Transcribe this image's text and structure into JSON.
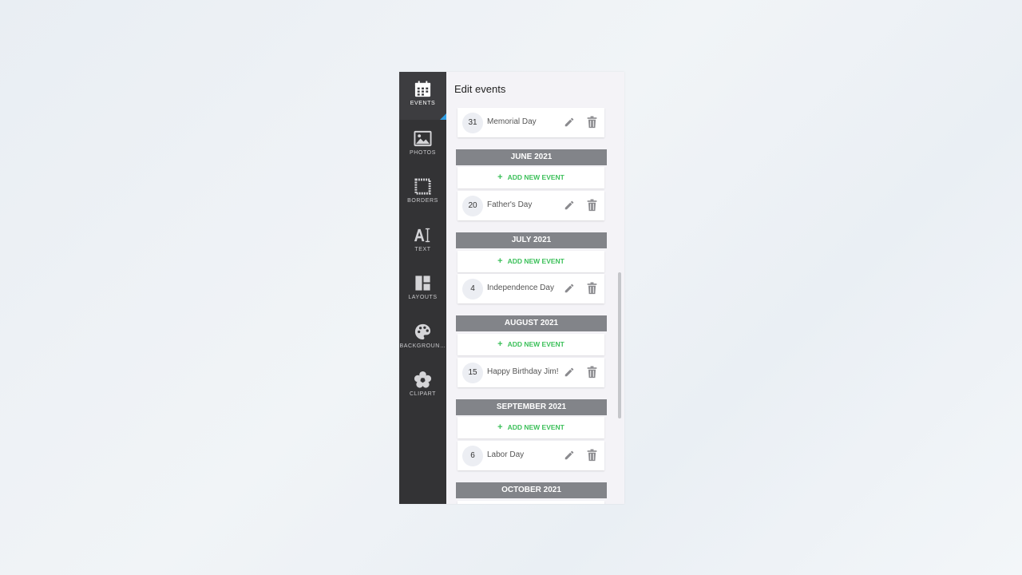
{
  "sidebar": {
    "items": [
      {
        "label": "EVENTS",
        "icon": "calendar-icon",
        "active": true
      },
      {
        "label": "PHOTOS",
        "icon": "image-icon"
      },
      {
        "label": "BORDERS",
        "icon": "border-frame-icon"
      },
      {
        "label": "TEXT",
        "icon": "text-icon"
      },
      {
        "label": "LAYOUTS",
        "icon": "layout-icon"
      },
      {
        "label": "BACKGROUN…",
        "icon": "palette-icon"
      },
      {
        "label": "CLIPART",
        "icon": "flower-icon"
      }
    ],
    "accent_color": "#2f9de3"
  },
  "panel": {
    "title": "Edit events",
    "add_label": "ADD NEW EVENT",
    "add_color": "#3cc05a",
    "events": {
      "memorial": {
        "day": "31",
        "name": "Memorial Day"
      },
      "fathers": {
        "day": "20",
        "name": "Father's Day"
      },
      "independence": {
        "day": "4",
        "name": "Independence Day"
      },
      "birthday": {
        "day": "15",
        "name": "Happy Birthday Jim!"
      },
      "labor": {
        "day": "6",
        "name": "Labor Day"
      }
    },
    "months": {
      "june": "JUNE 2021",
      "july": "JULY 2021",
      "august": "AUGUST 2021",
      "september": "SEPTEMBER 2021",
      "october": "OCTOBER 2021"
    }
  }
}
